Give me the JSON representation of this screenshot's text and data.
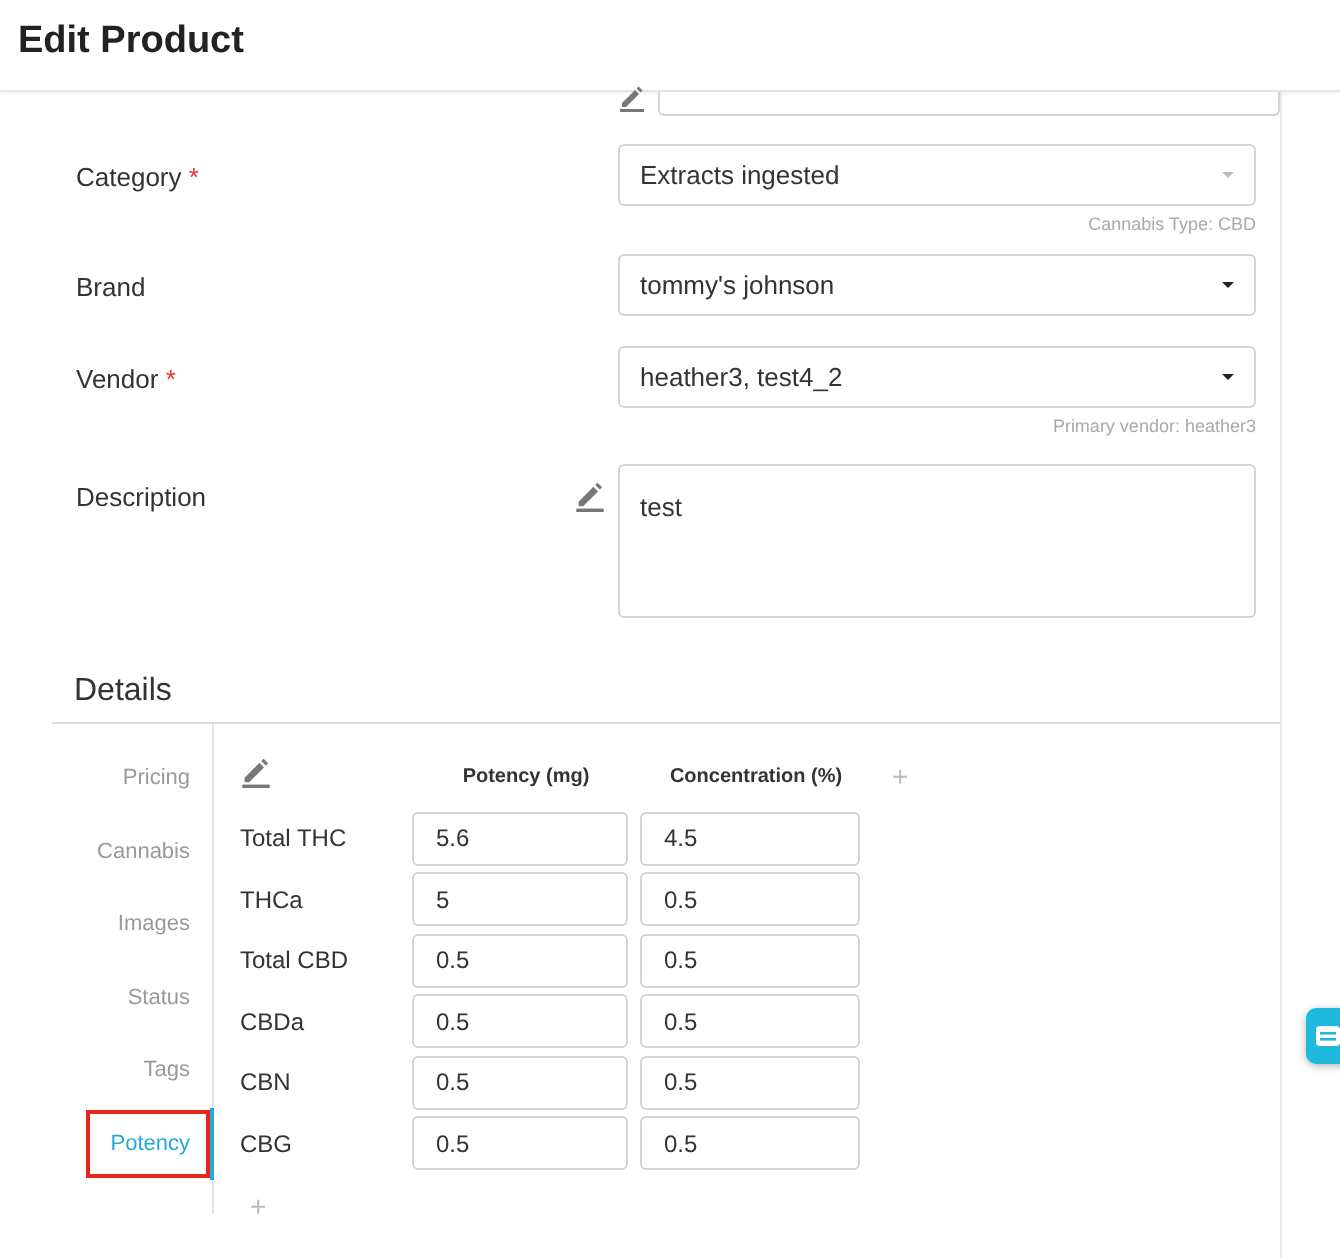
{
  "page": {
    "title": "Edit Product"
  },
  "fields": [
    {
      "kind": "select",
      "label": "Category",
      "required_mark": "*",
      "value": "Extracts ingested",
      "hint": "Cannabis Type: CBD",
      "disabled": true
    },
    {
      "kind": "select",
      "label": "Brand",
      "value": "tommy's johnson",
      "disabled": false
    },
    {
      "kind": "select",
      "label": "Vendor",
      "required_mark": "*",
      "value": "heather3, test4_2",
      "hint": "Primary vendor: heather3",
      "disabled": false
    },
    {
      "kind": "textarea",
      "label": "Description",
      "value": "test"
    }
  ],
  "details": {
    "title": "Details",
    "tabs": [
      {
        "label": "Pricing",
        "selected": false,
        "highlighted": false
      },
      {
        "label": "Cannabis",
        "selected": false,
        "highlighted": false
      },
      {
        "label": "Images",
        "selected": false,
        "highlighted": false
      },
      {
        "label": "Status",
        "selected": false,
        "highlighted": false
      },
      {
        "label": "Tags",
        "selected": false,
        "highlighted": false
      },
      {
        "label": "Potency",
        "selected": true,
        "highlighted": true
      }
    ],
    "columns": [
      "Potency (mg)",
      "Concentration (%)"
    ],
    "add_column": "+",
    "rows": [
      {
        "name": "Total THC",
        "potency": "5.6",
        "concentration": "4.5"
      },
      {
        "name": "THCa",
        "potency": "5",
        "concentration": "0.5"
      },
      {
        "name": "Total CBD",
        "potency": "0.5",
        "concentration": "0.5"
      },
      {
        "name": "CBDa",
        "potency": "0.5",
        "concentration": "0.5"
      },
      {
        "name": "CBN",
        "potency": "0.5",
        "concentration": "0.5"
      },
      {
        "name": "CBG",
        "potency": "0.5",
        "concentration": "0.5"
      }
    ],
    "add_row": "+"
  }
}
